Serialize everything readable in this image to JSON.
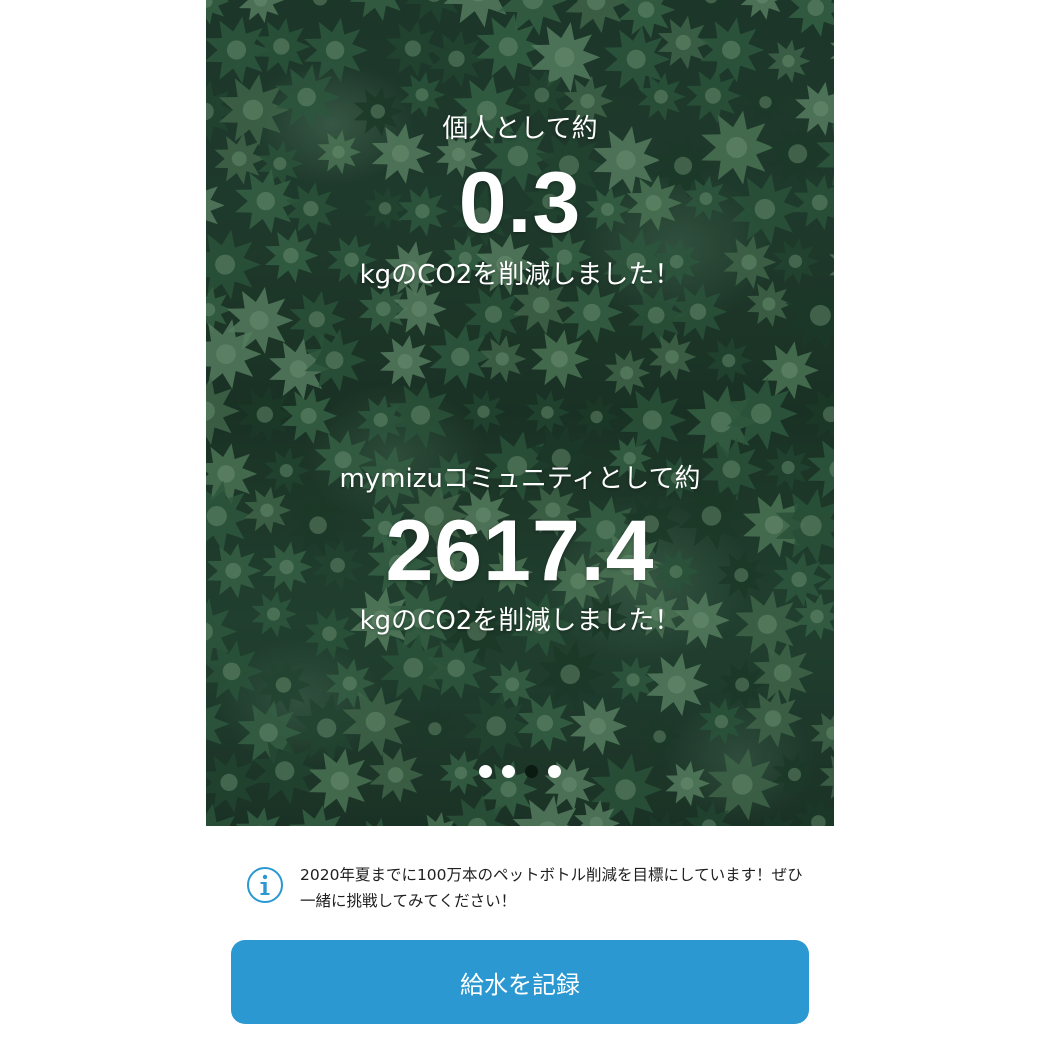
{
  "personal": {
    "prefix": "個人として約",
    "value": "0.3",
    "suffix": "kgのCO2を削減しました！"
  },
  "community": {
    "prefix": "mymizuコミュニティとして約",
    "value": "2617.4",
    "suffix": "kgのCO2を削減しました！"
  },
  "pager": {
    "count": 4,
    "active_index": 2
  },
  "info": {
    "icon": "info-icon",
    "text": "2020年夏までに100万本のペットボトル削減を目標にしています！ぜひ一緒に挑戦してみてください！"
  },
  "cta": {
    "label": "給水を記録"
  },
  "colors": {
    "accent": "#2b98d1",
    "dot_inactive": "#ffffff",
    "dot_active": "#0b1b12"
  }
}
